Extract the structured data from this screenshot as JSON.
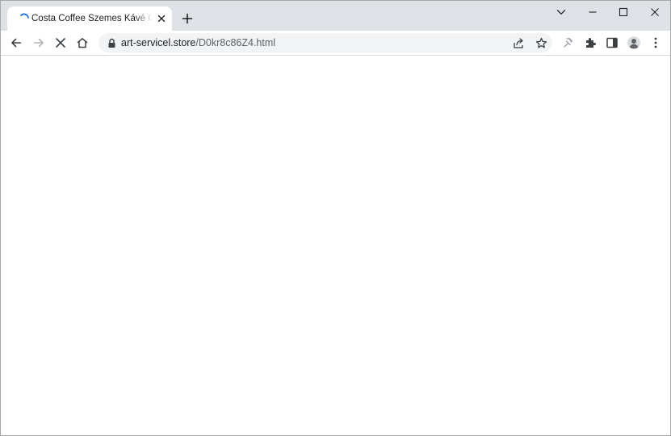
{
  "tab": {
    "title": "Costa Coffee Szemes Kávé One - ",
    "loading": true
  },
  "address_bar": {
    "host": "art-servicel.store",
    "path": "/D0kr8c86Z4.html"
  },
  "icons": {
    "tab_spinner": "loading-spinner-icon",
    "tab_close": "close-icon",
    "new_tab": "plus-icon",
    "tab_search": "chevron-down-icon",
    "minimize": "minimize-icon",
    "maximize": "maximize-icon",
    "close_window": "close-icon",
    "back": "arrow-left-icon",
    "forward": "arrow-right-icon",
    "stop": "close-icon",
    "home": "home-icon",
    "lock": "lock-icon",
    "share": "share-icon",
    "bookmark": "star-icon",
    "extension_disabled": "extension-off-icon",
    "extensions": "puzzle-icon",
    "side_panel": "side-panel-icon",
    "profile": "avatar-icon",
    "menu": "kebab-menu-icon"
  },
  "colors": {
    "tabstrip_bg": "#dee1e6",
    "omnibox_bg": "#f1f3f4",
    "icon": "#5f6368",
    "spinner": "#1a73e8"
  }
}
